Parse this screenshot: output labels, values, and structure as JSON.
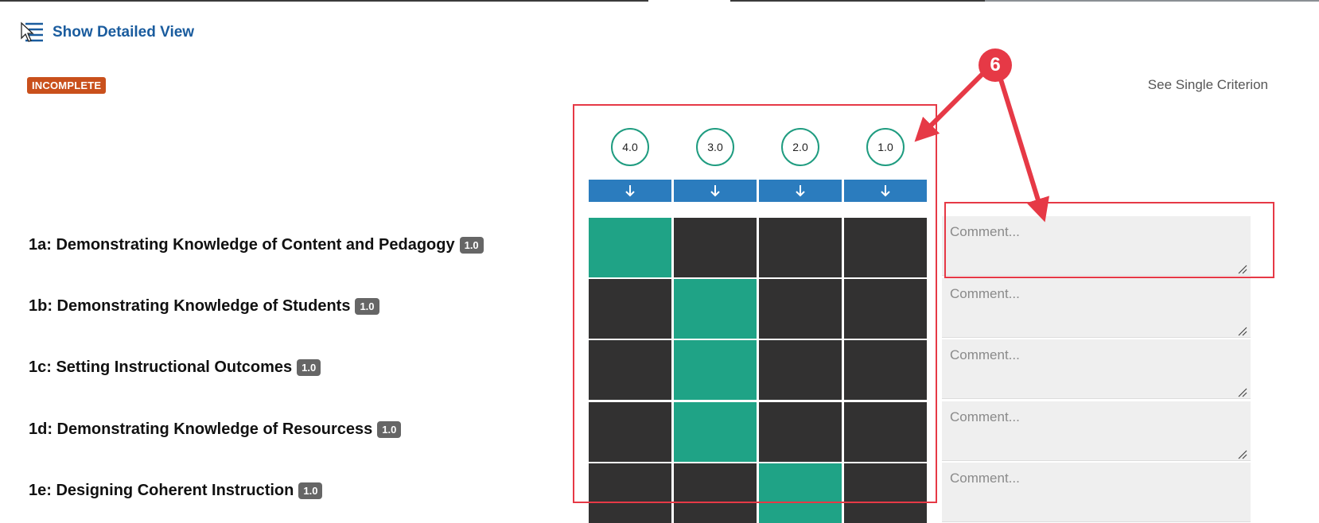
{
  "header": {
    "detailed_view_label": "Show Detailed View",
    "status_badge": "INCOMPLETE",
    "single_criterion_link": "See Single Criterion"
  },
  "rubric": {
    "score_levels": [
      "4.0",
      "3.0",
      "2.0",
      "1.0"
    ],
    "criteria": [
      {
        "label": "1a: Demonstrating Knowledge of Content and Pedagogy",
        "weight": "1.0",
        "selected_level": "4.0"
      },
      {
        "label": "1b: Demonstrating Knowledge of Students",
        "weight": "1.0",
        "selected_level": "3.0"
      },
      {
        "label": "1c: Setting Instructional Outcomes",
        "weight": "1.0",
        "selected_level": "3.0"
      },
      {
        "label": "1d: Demonstrating Knowledge of Resourcess",
        "weight": "1.0",
        "selected_level": "3.0"
      },
      {
        "label": "1e: Designing Coherent Instruction",
        "weight": "1.0",
        "selected_level": "2.0"
      }
    ],
    "comment_placeholder": "Comment..."
  },
  "annotation": {
    "callout_number": "6",
    "color": "#e63946"
  },
  "colors": {
    "selected": "#1fa386",
    "unselected": "#323131",
    "arrow_button": "#2b7cbe",
    "link": "#1a5c9e",
    "incomplete": "#c9501c"
  }
}
